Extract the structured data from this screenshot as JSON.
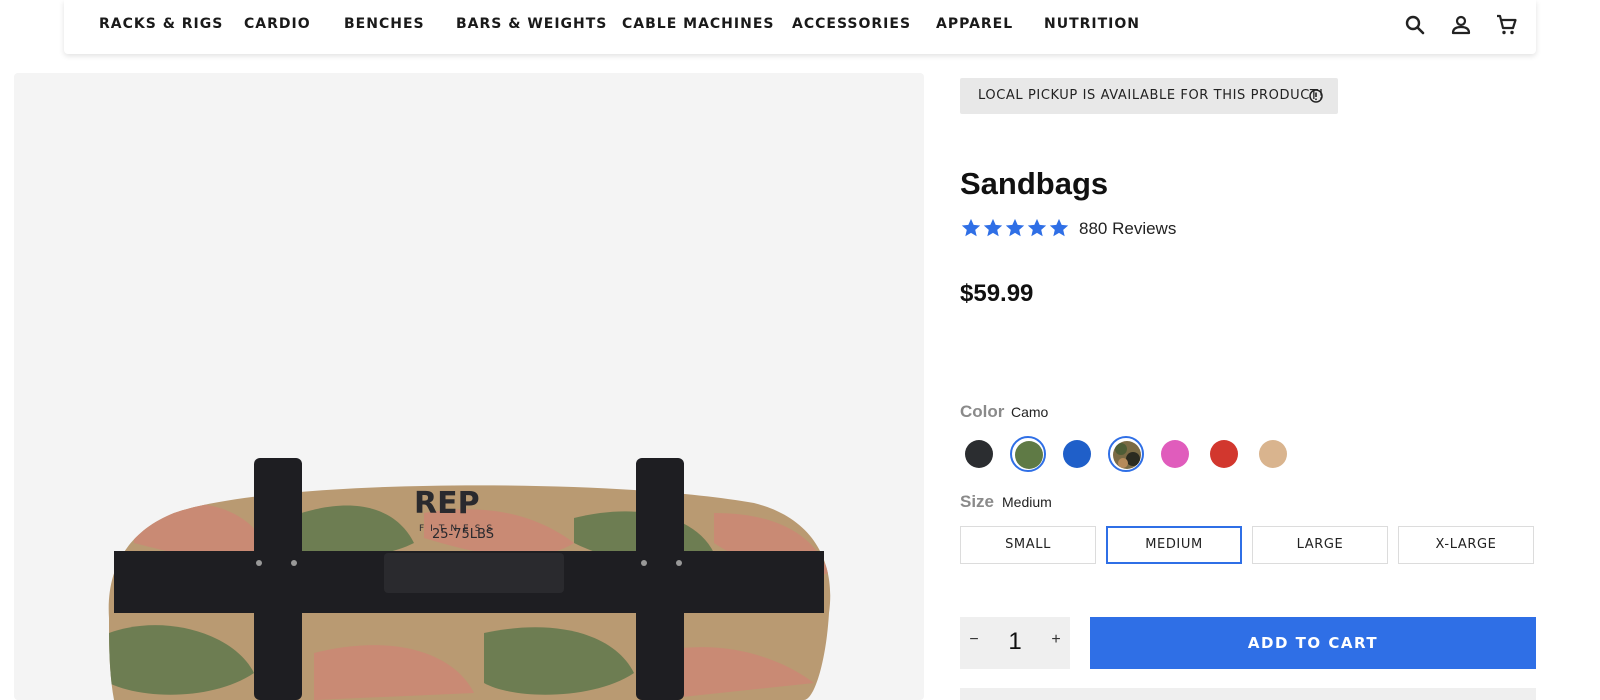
{
  "nav": {
    "items": [
      {
        "label": "RACKS & RIGS"
      },
      {
        "label": "CARDIO"
      },
      {
        "label": "BENCHES"
      },
      {
        "label": "BARS & WEIGHTS"
      },
      {
        "label": "CABLE MACHINES"
      },
      {
        "label": "ACCESSORIES"
      },
      {
        "label": "APPAREL"
      },
      {
        "label": "NUTRITION"
      }
    ],
    "icons": [
      "search-icon",
      "account-icon",
      "cart-icon"
    ]
  },
  "product": {
    "pickup_notice": "LOCAL PICKUP IS AVAILABLE FOR THIS PRODUCT!",
    "pickup_icon": "info-icon",
    "title": "Sandbags",
    "rating": 5,
    "reviews": "880 Reviews",
    "price": "$59.99",
    "star_color": "#2f6fe6"
  },
  "options": {
    "color_label": "Color",
    "color_value": "Camo",
    "colors": [
      {
        "name": "black",
        "hex": "#2b2d30",
        "selected": false
      },
      {
        "name": "green",
        "hex": "#5f7a45",
        "selected": true
      },
      {
        "name": "blue",
        "hex": "#1f5fc9",
        "selected": false
      },
      {
        "name": "camo",
        "hex": "#7b6b45",
        "selected": true
      },
      {
        "name": "pink",
        "hex": "#e05cbc",
        "selected": false
      },
      {
        "name": "red",
        "hex": "#d2372e",
        "selected": false
      },
      {
        "name": "tan",
        "hex": "#d9b48e",
        "selected": false
      }
    ],
    "size_label": "Size",
    "size_value": "Medium",
    "sizes": [
      {
        "label": "SMALL",
        "selected": false
      },
      {
        "label": "MEDIUM",
        "selected": true
      },
      {
        "label": "LARGE",
        "selected": false
      },
      {
        "label": "X-LARGE",
        "selected": false
      }
    ]
  },
  "purchase": {
    "quantity": "1",
    "minus": "−",
    "plus": "+",
    "add_to_cart": "ADD TO CART",
    "accent": "#2f6fe6"
  },
  "image": {
    "brand_text": "REP",
    "sub_text": "FITNESS",
    "weight_text": "25-75LBS"
  }
}
